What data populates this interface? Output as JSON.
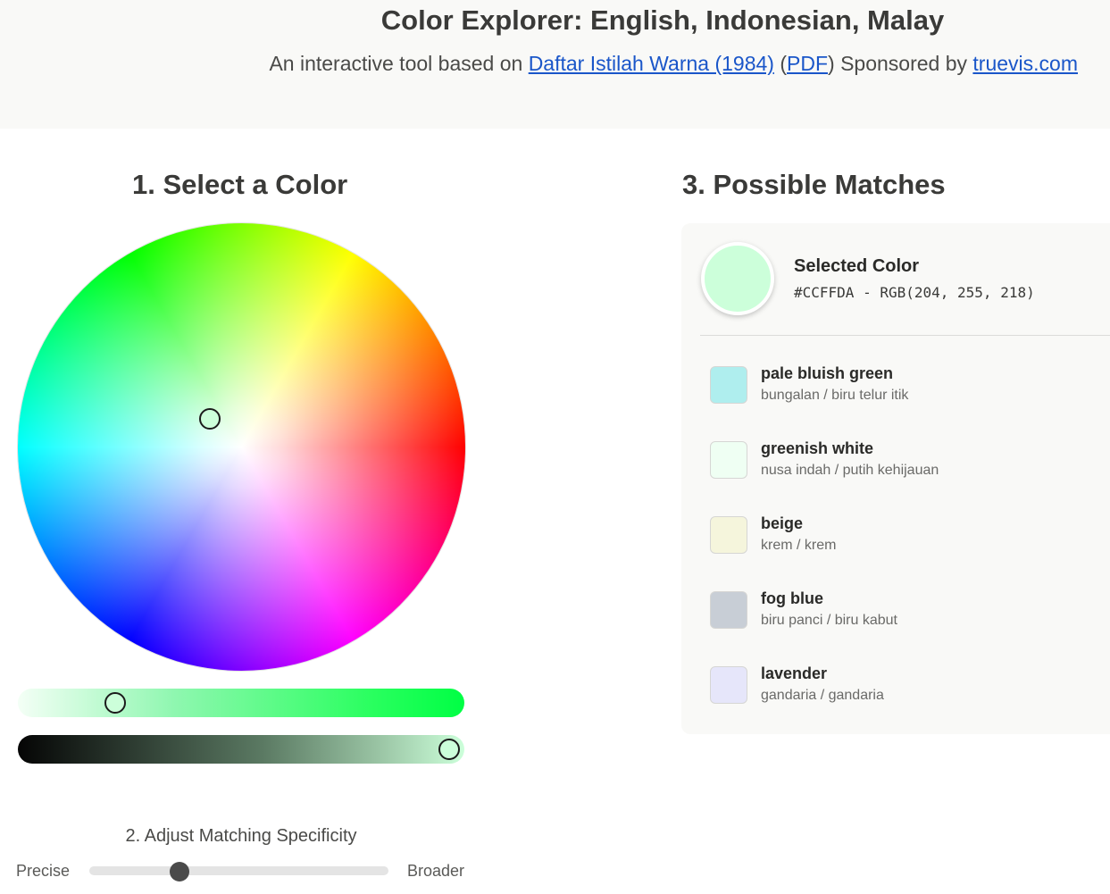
{
  "header": {
    "title": "Color Explorer: English, Indonesian, Malay",
    "subtitle_prefix": "An interactive tool based on ",
    "link_daftar": "Daftar Istilah Warna (1984)",
    "paren_open": " (",
    "link_pdf": "PDF",
    "paren_close": ")",
    "sponsored": " Sponsored by ",
    "link_sponsor": "truevis.com"
  },
  "select": {
    "heading": "1. Select a Color"
  },
  "adjust": {
    "label": "2. Adjust Matching Specificity",
    "left_label": "Precise",
    "right_label": "Broader",
    "slider_value": 0.3
  },
  "matches": {
    "heading": "3. Possible Matches",
    "selected_title": "Selected Color",
    "selected_code": "#CCFFDA - RGB(204, 255, 218)",
    "selected_color": "#ccffda",
    "items": [
      {
        "english": "pale bluish green",
        "local": "bungalan / biru telur itik",
        "color": "#afeeee"
      },
      {
        "english": "greenish white",
        "local": "nusa indah / putih kehijauan",
        "color": "#effff3"
      },
      {
        "english": "beige",
        "local": "krem / krem",
        "color": "#f5f5dc"
      },
      {
        "english": "fog blue",
        "local": "biru panci / biru kabut",
        "color": "#c8ced6"
      },
      {
        "english": "lavender",
        "local": "gandaria / gandaria",
        "color": "#e6e6fa"
      }
    ]
  },
  "icons": {
    "wheel_handle": "color-picker-handle-icon",
    "slider_handle": "slider-handle-icon"
  }
}
